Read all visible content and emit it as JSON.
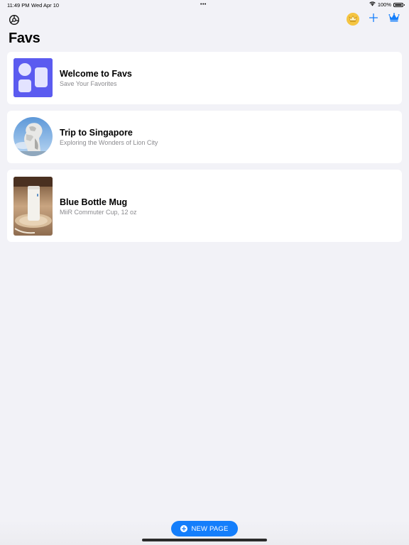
{
  "status_bar": {
    "time": "11:49 PM",
    "date": "Wed Apr 10",
    "dots": "•••",
    "battery": "100%"
  },
  "nav": {
    "left_icon": "settings-icon",
    "right_icons": [
      "crown-badge-icon",
      "plus-icon",
      "crown-icon"
    ]
  },
  "page": {
    "title": "Favs"
  },
  "cards": [
    {
      "title": "Welcome to Favs",
      "subtitle": "Save Your Favorites",
      "thumb": "favs-logo"
    },
    {
      "title": "Trip to Singapore",
      "subtitle": "Exploring the Wonders of Lion City",
      "thumb": "merlion-photo"
    },
    {
      "title": "Blue Bottle Mug",
      "subtitle": "MiiR Commuter Cup, 12 oz",
      "thumb": "mug-photo"
    }
  ],
  "bottom": {
    "new_page_label": "NEW PAGE"
  },
  "colors": {
    "background": "#F2F2F7",
    "accent": "#147EFB",
    "logo_purple": "#5B5BF0",
    "crown_gold": "#F5C542"
  }
}
